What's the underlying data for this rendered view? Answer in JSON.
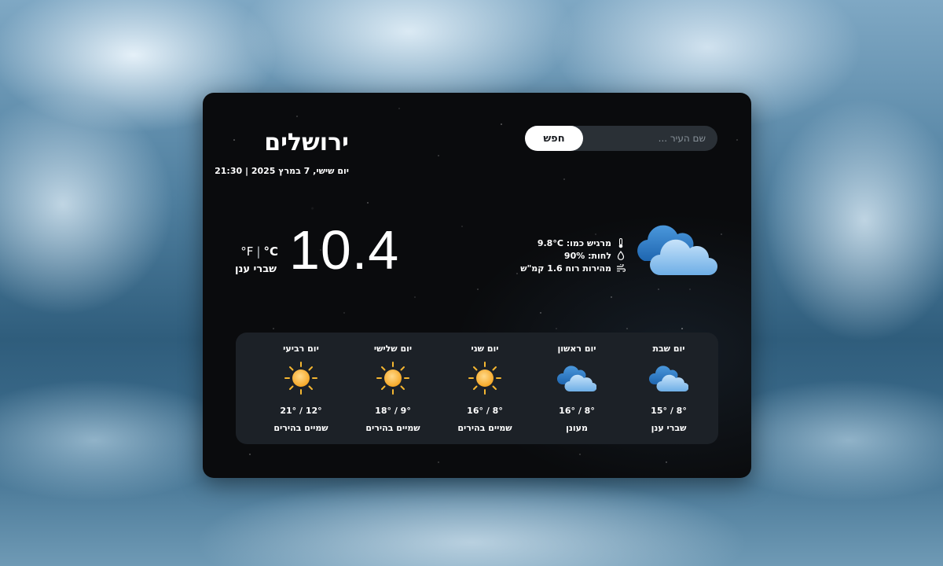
{
  "search": {
    "button_label": "חפש",
    "placeholder": "שם העיר ..."
  },
  "location": {
    "city": "ירושלים",
    "datetime": "יום שישי, 7 במרץ 2025 | 21:30"
  },
  "current": {
    "temperature": "10.4",
    "unit_celsius": "°C",
    "unit_separator": "|",
    "unit_fahrenheit": "°F",
    "condition": "שברי ענן",
    "icon": "cloud-icon",
    "feels_like": "מרגיש כמו: 9.8°C",
    "humidity": "לחות: 90%",
    "wind": "מהירות רוח 1.6 קמ\"ש"
  },
  "forecast": [
    {
      "day": "יום שבת",
      "temps": "8° / 15°",
      "desc": "שברי ענן",
      "icon": "cloud-icon"
    },
    {
      "day": "יום ראשון",
      "temps": "8° / 16°",
      "desc": "מעונן",
      "icon": "cloud-icon"
    },
    {
      "day": "יום שני",
      "temps": "8° / 16°",
      "desc": "שמיים בהירים",
      "icon": "sun-icon"
    },
    {
      "day": "יום שלישי",
      "temps": "9° / 18°",
      "desc": "שמיים בהירים",
      "icon": "sun-icon"
    },
    {
      "day": "יום רביעי",
      "temps": "12° / 21°",
      "desc": "שמיים בהירים",
      "icon": "sun-icon"
    }
  ],
  "colors": {
    "card_bg": "#0a0b0d",
    "forecast_bg": "#1c2127",
    "cloud_dark": "#2f7bc4",
    "cloud_light": "#a8d2f4",
    "sun": "#f7b733"
  }
}
